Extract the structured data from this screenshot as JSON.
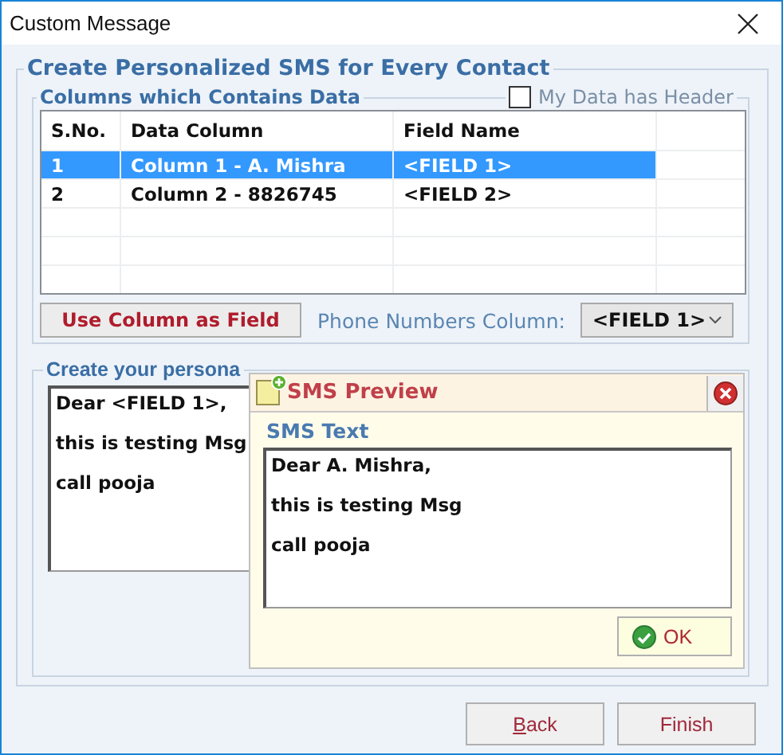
{
  "window": {
    "title": "Custom Message"
  },
  "main_group": {
    "title": "Create Personalized SMS for Every Contact"
  },
  "columns_group": {
    "title": "Columns which Contains Data",
    "header_checkbox": {
      "label": "My Data has Header",
      "checked": false
    }
  },
  "table": {
    "columns": [
      "S.No.",
      "Data Column",
      "Field Name"
    ],
    "rows": [
      {
        "cells": [
          "1",
          "Column 1 - A. Mishra",
          "<FIELD 1>"
        ],
        "selected": true
      },
      {
        "cells": [
          "2",
          "Column 2 - 8826745",
          "<FIELD 2>"
        ],
        "selected": false
      }
    ]
  },
  "use_column_button": "Use Column as Field",
  "phone_column": {
    "label": "Phone Numbers Column:",
    "value": "<FIELD 1>"
  },
  "message_group": {
    "title": "Create your persona",
    "lines": [
      "Dear <FIELD 1>,",
      "this is testing Msg",
      "call pooja"
    ]
  },
  "preview": {
    "title": "SMS Preview",
    "label": "SMS Text",
    "lines": [
      "Dear A. Mishra,",
      "this is testing Msg",
      "call pooja"
    ],
    "ok_button": "OK"
  },
  "buttons": [
    {
      "label": "Back"
    },
    {
      "label": "Finish"
    }
  ]
}
